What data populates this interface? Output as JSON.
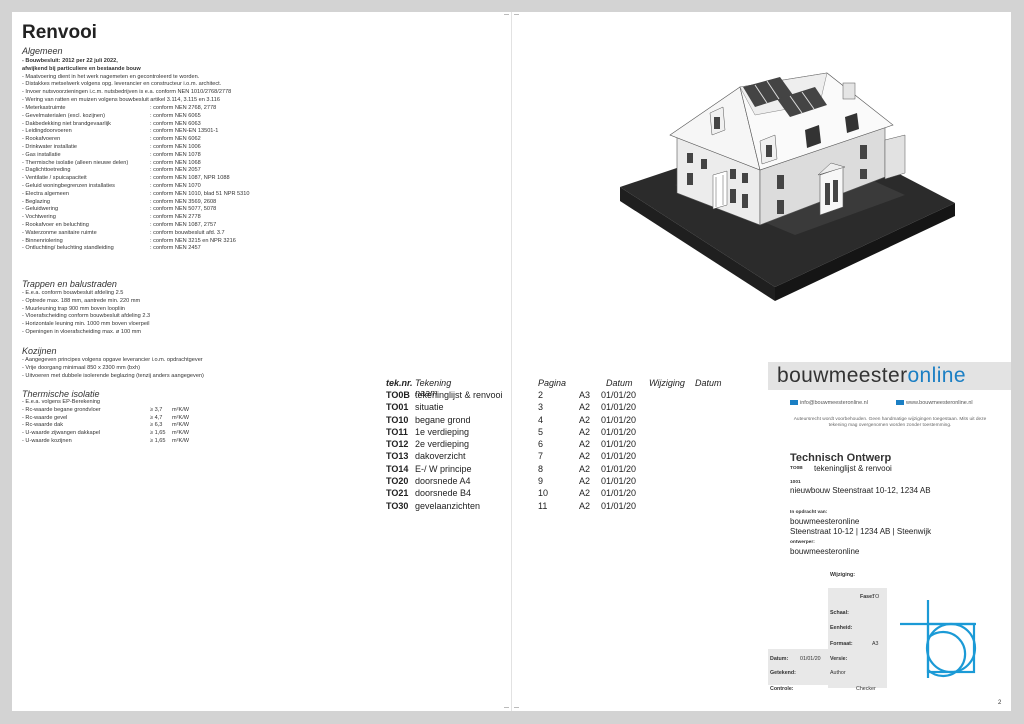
{
  "title": "Renvooi",
  "sections": {
    "algemeen": "Algemeen",
    "trappen": "Trappen en balustraden",
    "kozijnen": "Kozijnen",
    "isolatie": "Thermische isolatie"
  },
  "algemeen_lines": [
    "- Bouwbesluit: 2012 per 22 juli 2022,",
    "  afwijkend bij particuliere en bestaande bouw",
    "- Maatvoering dient in het werk nagemeten en gecontroleerd te worden.",
    "- Distakkes metselwerk volgens opg. leverancier en constructeur i.o.m. architect.",
    "- Invoer nutsvoorzieningen i.c.m. nutsbedrijven is e.a. conform NEN 1010/2768/2778",
    "- Wering van ratten en muizen volgens bouwbesluit artikel 3.114, 3.115 en 3.116"
  ],
  "norm_lines": [
    {
      "label": "- Meterkastruimte",
      "value": ": conform NEN 2768, 2778"
    },
    {
      "label": "- Gevelmaterialen (excl. kozijnen)",
      "value": ": conform NEN 6065"
    },
    {
      "label": "- Dakbedekking niet brandgevaarlijk",
      "value": ": conform NEN 6063"
    },
    {
      "label": "- Leidingdoorvoeren",
      "value": ": conform NEN-EN 13501-1"
    },
    {
      "label": "- Rookafvoeren",
      "value": ": conform NEN 6062"
    },
    {
      "label": "- Drinkwater installatie",
      "value": ": conform NEN 1006"
    },
    {
      "label": "- Gas installatie",
      "value": ": conform NEN 1078"
    },
    {
      "label": "- Thermische isolatie (alleen nieuwe delen)",
      "value": ": conform NEN 1068"
    },
    {
      "label": "- Daglichttoetreding",
      "value": ": conform NEN 2057"
    },
    {
      "label": "- Ventilatie / spuicapaciteit",
      "value": ": conform NEN 1087, NPR 1088"
    },
    {
      "label": "- Geluid woningbegrenzen installaties",
      "value": ": conform NEN 1070"
    },
    {
      "label": "- Electra algemeen",
      "value": ": conform NEN 1010, blad 51 NPR 5310"
    },
    {
      "label": "- Beglazing",
      "value": ": conform NEN 3569, 2608"
    },
    {
      "label": "- Geluidwering",
      "value": ": conform NEN 5077, 5078"
    },
    {
      "label": "- Vochtwering",
      "value": ": conform NEN 2778"
    },
    {
      "label": "- Rookafvoer en beluchting",
      "value": ": conform NEN 1087, 2757"
    },
    {
      "label": "- Waterzonme sanitaire ruimte",
      "value": ": conform bouwbesluit afd. 3.7"
    },
    {
      "label": "- Binnenriolering",
      "value": ": conform NEN 3215 en NPR 3216"
    },
    {
      "label": "- Ontluchting/ beluchting standleiding",
      "value": ": conform NEN 2457"
    }
  ],
  "trappen_lines": [
    "- E.e.a. conform bouwbesluit afdeling 2.5",
    "- Optrede max. 188 mm, aantrede min. 220 mm",
    "- Muurleuning trap 900 mm boven loopliin",
    "- Vloerafscheiding conform bouwbesluit afdeling 2.3",
    "- Horizontale leuning min. 1000 mm boven vloerpeil",
    "- Openingen in vloerafscheiding max. ø 100 mm"
  ],
  "kozijnen_lines": [
    "- Aangegeven principes volgens opgave leverancier i.o.m. opdrachtgever",
    "- Vrije doorgang minimaal 850 x 2300 mm (bxh)",
    "- Uitvoeren met dubbele isolerende beglazing (tenzij anders aangegeven)"
  ],
  "isolatie_lines": [
    {
      "label": "- E.e.a. volgens EP-Berekening",
      "v1": "",
      "v2": ""
    },
    {
      "label": "- Rc-waarde begane grondvloer",
      "v1": "≥ 3,7",
      "v2": "m²K/W"
    },
    {
      "label": "- Rc-waarde gevel",
      "v1": "≥ 4,7",
      "v2": "m²K/W"
    },
    {
      "label": "- Rc-waarde dak",
      "v1": "≥ 6,3",
      "v2": "m²K/W"
    },
    {
      "label": "- U-waarde zijwangen dakkapel",
      "v1": "≥ 1,65",
      "v2": "m²K/W"
    },
    {
      "label": "- U-waarde kozijnen",
      "v1": "≥ 1,65",
      "v2": "m²K/W"
    }
  ],
  "drawing_list": {
    "headers": [
      "tek.nr.",
      "Tekening naam",
      "Pagina",
      "Datum",
      "Wijziging",
      "Datum"
    ],
    "rows": [
      {
        "nr": "TO0B",
        "naam": "tekeninglijst & renvooi",
        "pagina": "2",
        "formaat": "A3",
        "datum": "01/01/20"
      },
      {
        "nr": "TO01",
        "naam": "situatie",
        "pagina": "3",
        "formaat": "A2",
        "datum": "01/01/20"
      },
      {
        "nr": "TO10",
        "naam": "begane grond",
        "pagina": "4",
        "formaat": "A2",
        "datum": "01/01/20"
      },
      {
        "nr": "TO11",
        "naam": "1e verdieping",
        "pagina": "5",
        "formaat": "A2",
        "datum": "01/01/20"
      },
      {
        "nr": "TO12",
        "naam": "2e verdieping",
        "pagina": "6",
        "formaat": "A2",
        "datum": "01/01/20"
      },
      {
        "nr": "TO13",
        "naam": "dakoverzicht",
        "pagina": "7",
        "formaat": "A2",
        "datum": "01/01/20"
      },
      {
        "nr": "TO14",
        "naam": "E-/ W principe",
        "pagina": "8",
        "formaat": "A2",
        "datum": "01/01/20"
      },
      {
        "nr": "TO20",
        "naam": "doorsnede A4",
        "pagina": "9",
        "formaat": "A2",
        "datum": "01/01/20"
      },
      {
        "nr": "TO21",
        "naam": "doorsnede B4",
        "pagina": "10",
        "formaat": "A2",
        "datum": "01/01/20"
      },
      {
        "nr": "TO30",
        "naam": "gevelaanzichten",
        "pagina": "11",
        "formaat": "A2",
        "datum": "01/01/20"
      }
    ]
  },
  "titleblock": {
    "brand_a": "bouwmeester",
    "brand_b": "online",
    "email": "info@bouwmeesteronline.nl",
    "website": "www.bouwmeesteronline.nl",
    "disclaimer": "Auteursrecht wordt voorbehouden. Geen handmatige wijzigingen toegestaan. Mits uit deze tekening mag overgenomen worden zonder toestemming.",
    "heading": "Technisch Ontwerp",
    "code_label": "TO0B",
    "code_value": "tekeninglijst & renvooi",
    "project_label": "1001",
    "project_value": "nieuwbouw Steenstraat 10-12, 1234 AB",
    "client_label": "In opdracht van:",
    "client_line1": "bouwmeesteronline",
    "client_line2": "Steenstraat 10-12 | 1234 AB | Steenwijk",
    "designer_label": "ontwerper:",
    "designer_value": "bouwmeesteronline",
    "wijziging_label": "Wijziging:",
    "fase_label": "Fase:",
    "fase_value": "TO",
    "schaal_label": "Schaal:",
    "eenheid_label": "Eenheid:",
    "formaat_label": "Formaat:",
    "formaat_value": "A3",
    "datum_label": "Datum:",
    "datum_value": "01/01/20",
    "versie_label": "Versie:",
    "getekend_label": "Getekend:",
    "getekend_value": "Author",
    "controle_label": "Controle:",
    "controle_value": "Checker",
    "logo_color": "#1b9ad6"
  },
  "page_number": "2"
}
